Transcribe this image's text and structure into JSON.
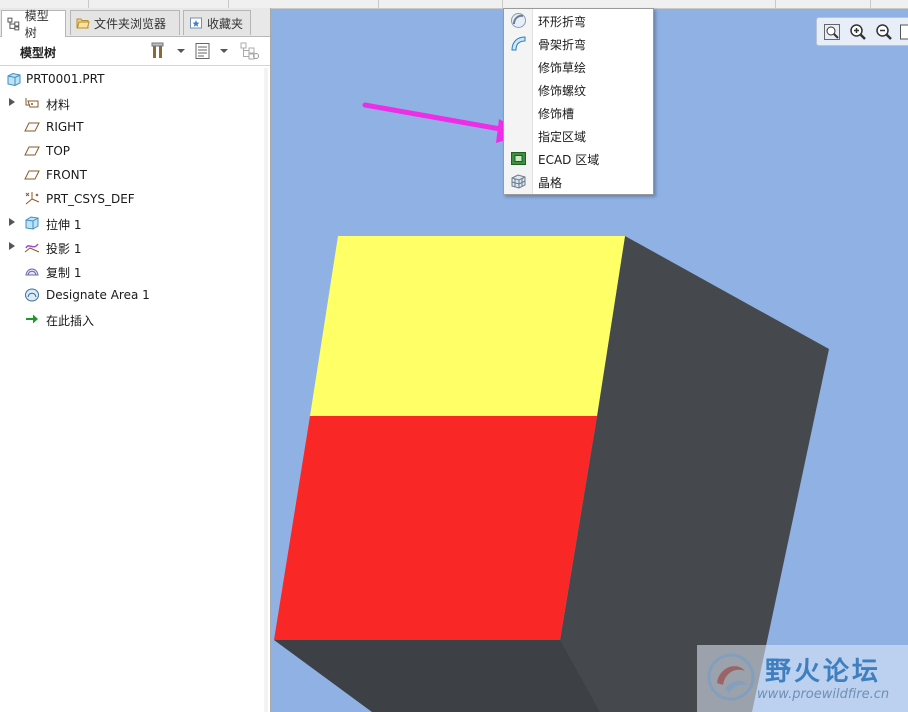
{
  "tabs": [
    {
      "label": "模型树",
      "icon": "model-tree-icon"
    },
    {
      "label": "文件夹浏览器",
      "icon": "folder-browser-icon"
    },
    {
      "label": "收藏夹",
      "icon": "favorites-icon"
    }
  ],
  "tree_header": {
    "title": "模型树",
    "settings_icon": "tree-settings-icon",
    "columns_icon": "tree-columns-icon",
    "filter_icon": "tree-filter-icon"
  },
  "tree": {
    "root": {
      "label": "PRT0001.PRT",
      "icon": "part-icon"
    },
    "items": [
      {
        "label": "材料",
        "icon": "material-icon",
        "expandable": true
      },
      {
        "label": "RIGHT",
        "icon": "datum-plane-icon",
        "expandable": false
      },
      {
        "label": "TOP",
        "icon": "datum-plane-icon",
        "expandable": false
      },
      {
        "label": "FRONT",
        "icon": "datum-plane-icon",
        "expandable": false
      },
      {
        "label": "PRT_CSYS_DEF",
        "icon": "coordinate-system-icon",
        "expandable": false
      },
      {
        "label": "拉伸 1",
        "icon": "extrude-icon",
        "expandable": true
      },
      {
        "label": "投影 1",
        "icon": "projection-icon",
        "expandable": true
      },
      {
        "label": "复制 1",
        "icon": "copy-icon",
        "expandable": false
      },
      {
        "label": "Designate Area 1",
        "icon": "designate-area-icon",
        "expandable": false
      },
      {
        "label": "在此插入",
        "icon": "insert-here-arrow-icon",
        "expandable": false
      }
    ]
  },
  "menu": {
    "items": [
      {
        "label": "环形折弯",
        "icon": "toroidal-bend-icon"
      },
      {
        "label": "骨架折弯",
        "icon": "spinal-bend-icon"
      },
      {
        "label": "修饰草绘",
        "icon": ""
      },
      {
        "label": "修饰螺纹",
        "icon": ""
      },
      {
        "label": "修饰槽",
        "icon": ""
      },
      {
        "label": "指定区域",
        "icon": ""
      },
      {
        "label": "ECAD 区域",
        "icon": "ecad-area-icon"
      },
      {
        "label": "晶格",
        "icon": "lattice-icon"
      }
    ]
  },
  "view_toolbar": {
    "buttons": [
      "zoom-fit-icon",
      "zoom-in-icon",
      "zoom-out-icon",
      "repaint-icon"
    ]
  },
  "canvas": {
    "background": "#8fb1e4",
    "face_top": "#ffff66",
    "face_front": "#fa2727",
    "face_side": "#45494e",
    "annotation_arrow_color": "#ee2ee6"
  },
  "watermark": {
    "title": "野火论坛",
    "url": "www.proewildfire.cn"
  }
}
